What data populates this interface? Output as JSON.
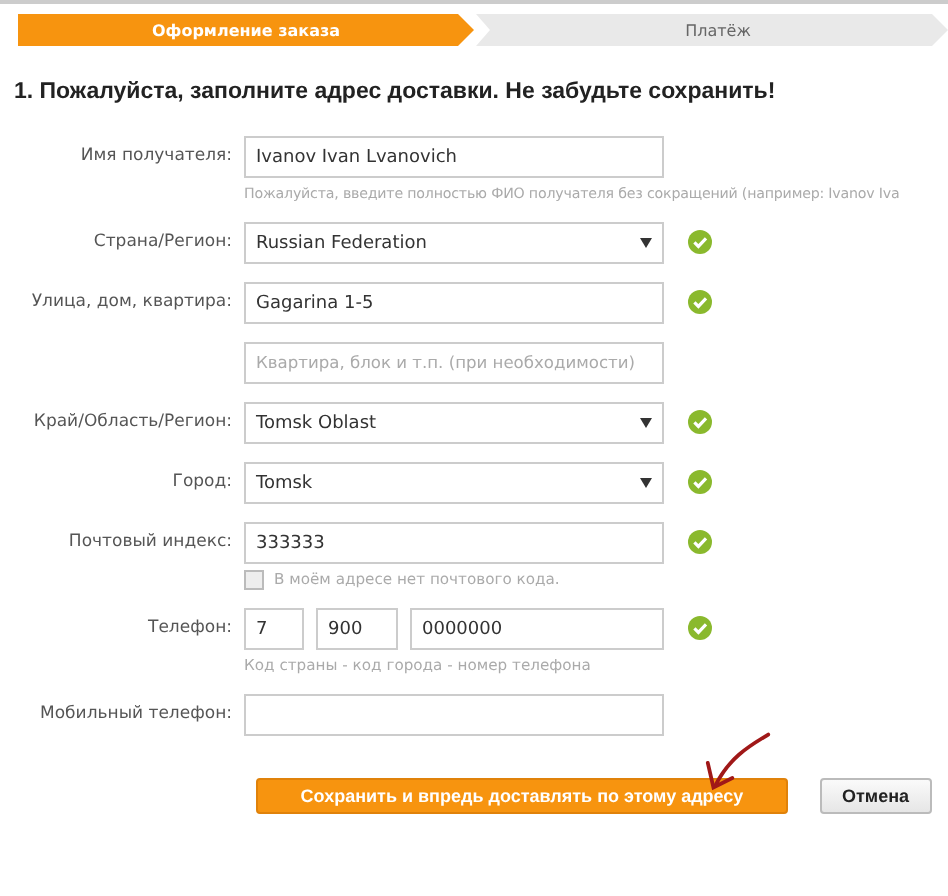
{
  "steps": [
    {
      "label": "Оформление заказа",
      "selected": true
    },
    {
      "label": "Платёж",
      "selected": false
    }
  ],
  "heading": "1. Пожалуйста, заполните адрес доставки. Не забудьте сохранить!",
  "fields": [
    {
      "kind": "text",
      "label": "Имя получателя:",
      "value": "Ivanov Ivan Lvanovich",
      "valid": false,
      "hint": "Пожалуйста, введите полностью ФИО получателя без сокращений (например: Ivanov Iva"
    },
    {
      "kind": "select",
      "label": "Страна/Регион:",
      "value": "Russian Federation",
      "valid": true
    },
    {
      "kind": "text",
      "label": "Улица, дом, квартира:",
      "value": "Gagarina 1-5",
      "valid": true
    },
    {
      "kind": "text",
      "placeholder": "Квартира, блок и т.п. (при необходимости)",
      "valid": false
    },
    {
      "kind": "select",
      "label": "Край/Область/Регион:",
      "value": "Tomsk Oblast",
      "valid": true
    },
    {
      "kind": "select",
      "label": "Город:",
      "value": "Tomsk",
      "valid": true
    },
    {
      "kind": "text",
      "label": "Почтовый индекс:",
      "value": "333333",
      "valid": true,
      "checkbox": {
        "label": "В моём адресе нет почтового кода.",
        "checked": false
      }
    },
    {
      "kind": "phone",
      "label": "Телефон:",
      "parts": [
        "7",
        "900",
        "0000000"
      ],
      "valid": true,
      "hint": "Код страны - код города - номер телефона"
    },
    {
      "kind": "text",
      "label": "Мобильный телефон:",
      "valid": false
    }
  ],
  "buttons": [
    {
      "label": "Сохранить и впредь доставлять по этому адресу",
      "kind": "primary"
    },
    {
      "label": "Отмена",
      "kind": "secondary"
    }
  ]
}
